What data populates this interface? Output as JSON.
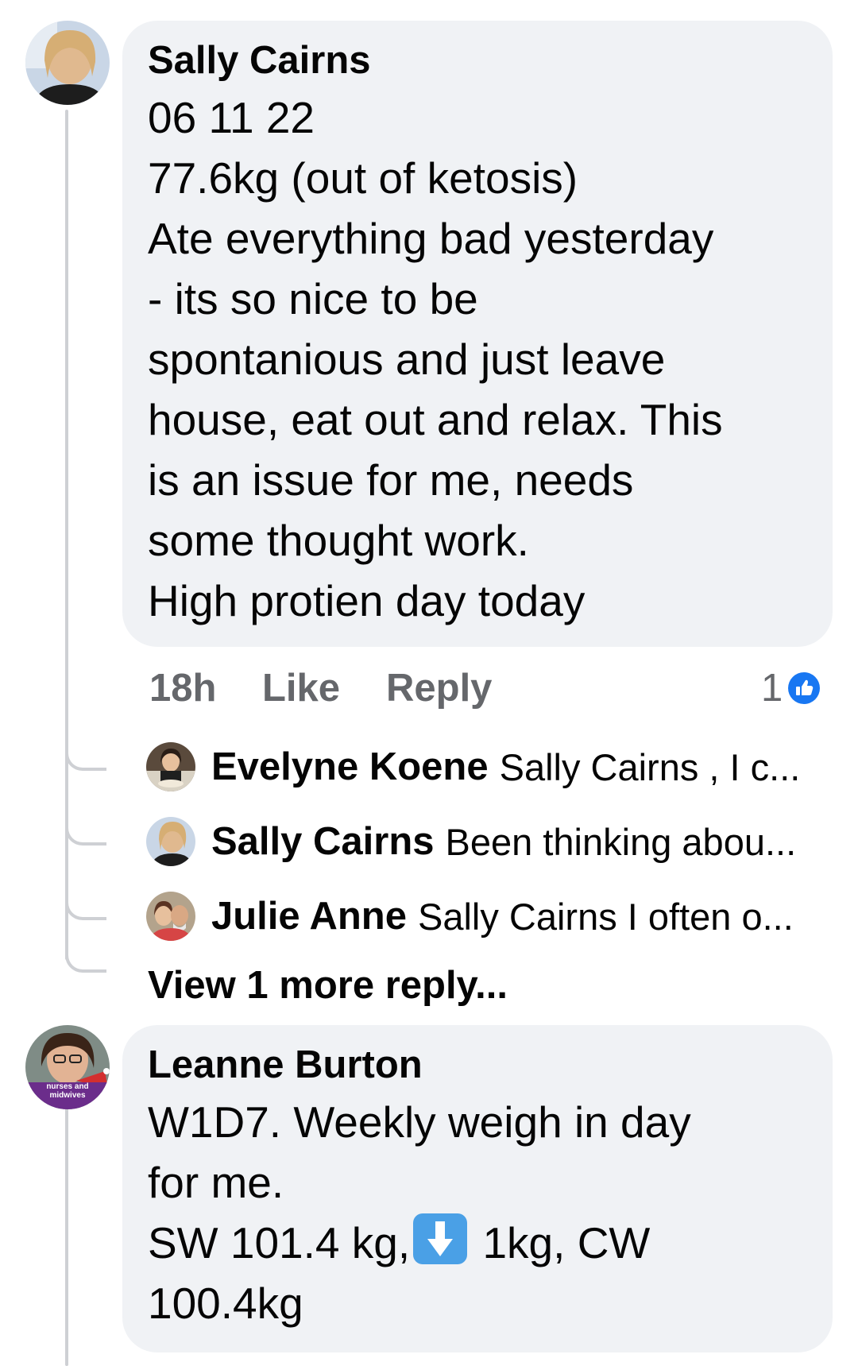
{
  "comments": [
    {
      "author": "Sally Cairns",
      "lines": [
        "06 11 22",
        "77.6kg (out of ketosis)",
        "Ate everything bad yesterday",
        "- its so nice to be",
        "spontanious and just leave",
        "house, eat out and relax. This",
        "is an issue for me, needs",
        "some thought work.",
        "High protien day today"
      ],
      "time": "18h",
      "like_label": "Like",
      "reply_label": "Reply",
      "reaction_count": "1",
      "reaction_icon": "like-icon",
      "replies": [
        {
          "name": "Evelyne Koene",
          "text": "Sally Cairns , I c..."
        },
        {
          "name": "Sally Cairns",
          "text": "Been thinking abou..."
        },
        {
          "name": "Julie Anne",
          "text": "Sally Cairns I often o..."
        }
      ],
      "view_more": "View 1 more reply..."
    },
    {
      "author": "Leanne Burton",
      "avatar_badge": [
        "nurses and",
        "midwives"
      ],
      "lines": [
        "W1D7. Weekly weigh in day",
        "for me."
      ],
      "line3_before": "SW 101.4 kg,",
      "line3_after": " 1kg, CW",
      "line4": "100.4kg",
      "emoji": "down-arrow-icon"
    }
  ],
  "colors": {
    "bubble": "#f0f2f5",
    "meta": "#65676b",
    "like_blue": "#1877f2",
    "thread_line": "#ced0d4"
  }
}
